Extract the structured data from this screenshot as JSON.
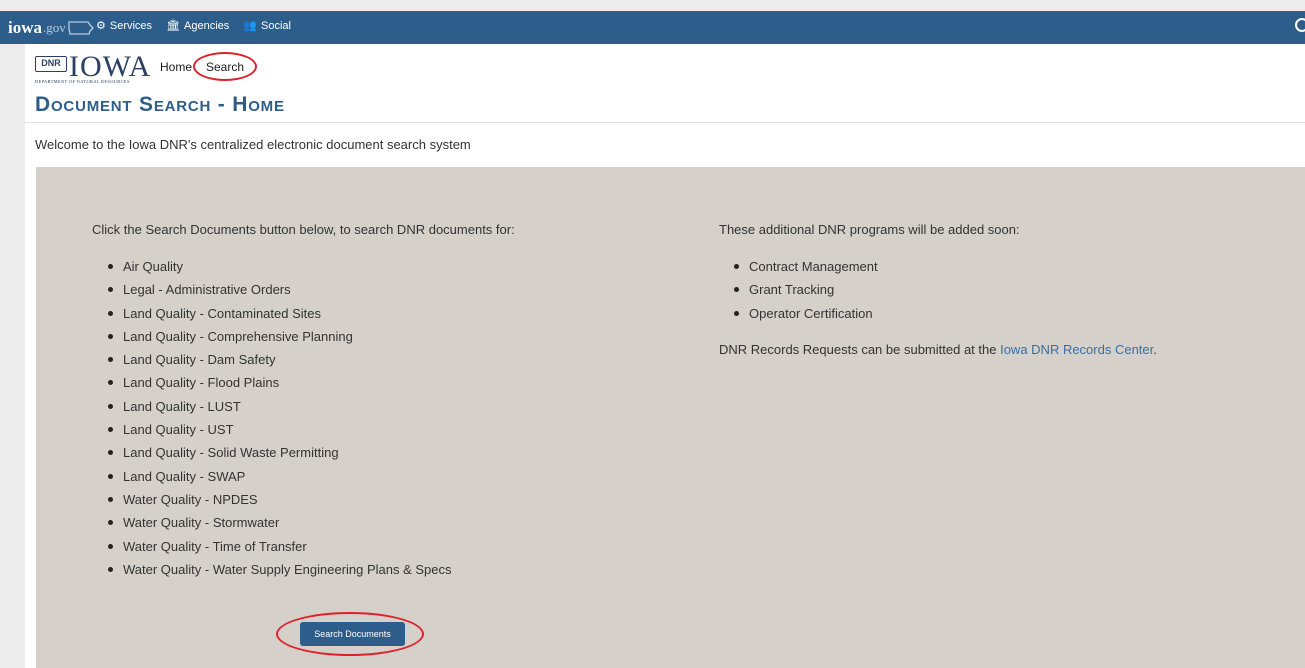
{
  "topbar": {
    "logo_word": "iowa",
    "logo_suffix": ".gov",
    "nav": [
      {
        "label": "Services",
        "icon": "gears-icon"
      },
      {
        "label": "Agencies",
        "icon": "building-icon"
      },
      {
        "label": "Social",
        "icon": "users-icon"
      }
    ],
    "search_icon": "search-icon"
  },
  "brand": {
    "badge": "DNR",
    "iowa": "IOWA",
    "department": "DEPARTMENT OF NATURAL RESOURCES"
  },
  "breadcrumb": {
    "home": "Home",
    "search": "Search"
  },
  "page": {
    "title": "Document Search - Home",
    "welcome": "Welcome to the Iowa DNR's centralized electronic document search system"
  },
  "left": {
    "intro": "Click the Search Documents button below, to search DNR documents for:",
    "items": [
      "Air Quality",
      "Legal - Administrative Orders",
      "Land Quality - Contaminated Sites",
      "Land Quality - Comprehensive Planning",
      "Land Quality - Dam Safety",
      "Land Quality - Flood Plains",
      "Land Quality - LUST",
      "Land Quality - UST",
      "Land Quality - Solid Waste Permitting",
      "Land Quality - SWAP",
      "Water Quality - NPDES",
      "Water Quality - Stormwater",
      "Water Quality - Time of Transfer",
      "Water Quality - Water Supply Engineering Plans & Specs"
    ],
    "button": "Search Documents"
  },
  "right": {
    "intro": "These additional DNR programs will be added soon:",
    "items": [
      "Contract Management",
      "Grant Tracking",
      "Operator Certification"
    ],
    "records_prefix": "DNR Records Requests can be submitted at the ",
    "records_link": "Iowa DNR Records Center",
    "records_suffix": "."
  },
  "colors": {
    "topbar": "#2d5d8a",
    "panel": "#d5d1ca",
    "title": "#2d5d8a",
    "link": "#3a6ea5",
    "annotation": "#e0202a"
  }
}
